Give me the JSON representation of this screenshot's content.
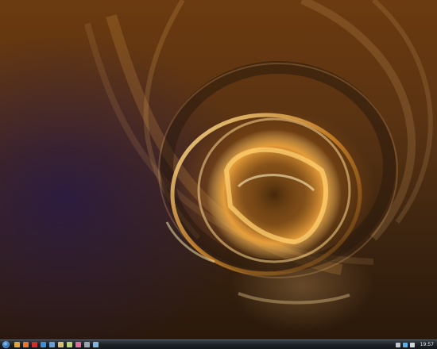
{
  "desktop": {
    "wallpaper": "abstract-orange-swirl"
  },
  "taskbar": {
    "start_icon": "windows-start-orb-icon",
    "quick_launch": [
      {
        "icon": "media-player-icon",
        "color": "#d9a441"
      },
      {
        "icon": "firefox-icon",
        "color": "#e8752a"
      },
      {
        "icon": "flag-icon",
        "color": "#c9302c"
      },
      {
        "icon": "internet-explorer-icon",
        "color": "#3a8fd8"
      },
      {
        "icon": "computer-icon",
        "color": "#6aa0d0"
      },
      {
        "icon": "documents-icon",
        "color": "#d8c070"
      },
      {
        "icon": "photo-icon",
        "color": "#b8d07a"
      },
      {
        "icon": "pinwheel-icon",
        "color": "#e06aa0"
      },
      {
        "icon": "settings-icon",
        "color": "#9aa4b0"
      },
      {
        "icon": "window-icon",
        "color": "#80b4e0"
      }
    ],
    "tray_icons": [
      {
        "icon": "arrow-up-icon",
        "color": "#c0c8d0"
      },
      {
        "icon": "network-icon",
        "color": "#5fb0e8"
      },
      {
        "icon": "volume-icon",
        "color": "#d0d6dc"
      }
    ],
    "clock": "19:57"
  }
}
